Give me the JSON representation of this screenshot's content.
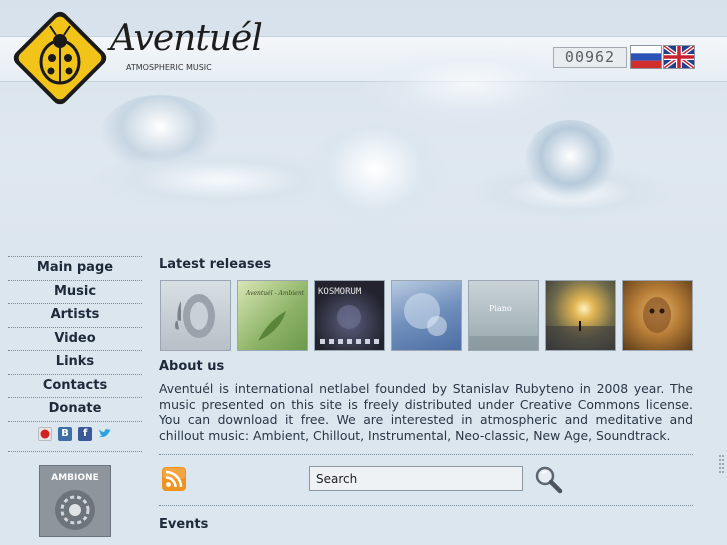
{
  "header": {
    "brand": "Aventuél",
    "tagline": "ATMOSPHERIC MUSIC",
    "visit_counter": "00962",
    "languages": [
      {
        "name": "russian-flag-icon"
      },
      {
        "name": "uk-flag-icon"
      }
    ]
  },
  "sidebar": {
    "nav": [
      {
        "label": "Main page"
      },
      {
        "label": "Music"
      },
      {
        "label": "Artists"
      },
      {
        "label": "Video"
      },
      {
        "label": "Links"
      },
      {
        "label": "Contacts"
      },
      {
        "label": "Donate"
      }
    ],
    "social_icons": [
      "lastfm-icon",
      "vkontakte-icon",
      "facebook-icon",
      "twitter-icon"
    ],
    "banner": {
      "text": "AMBIONE"
    }
  },
  "main": {
    "latest_title": "Latest releases",
    "covers": [
      {
        "name": "cover-speaker",
        "color": "#c7ced4"
      },
      {
        "name": "cover-green-leaf",
        "color": "#9fc07a",
        "text": "Aventuél - Ambient"
      },
      {
        "name": "cover-kosmorum",
        "color": "#2c2d3c",
        "text": "KOSMORUM"
      },
      {
        "name": "cover-blue-abstract",
        "color": "#8aa5c4"
      },
      {
        "name": "cover-piano",
        "color": "#b9c5c9",
        "text": "Piano"
      },
      {
        "name": "cover-sunset",
        "color": "#6d6c52"
      },
      {
        "name": "cover-golden-face",
        "color": "#b77d36"
      }
    ],
    "about_title": "About us",
    "about_text": "Aventuél is international netlabel founded by Stanislav Rubyteno in 2008 year. The music presented on this site is freely distributed under Creative Commons license. You can download it free. We are interested in atmospheric and meditative and chillout music: Ambient, Chillout, Instrumental, Neo-classic, New Age, Soundtrack.",
    "search": {
      "value": "",
      "placeholder": "Search"
    },
    "events_title": "Events"
  },
  "colors": {
    "background": "#dce6ee",
    "text": "#1e2a3a",
    "accent_logo": "#f2c41a",
    "rss": "#f0921e"
  }
}
